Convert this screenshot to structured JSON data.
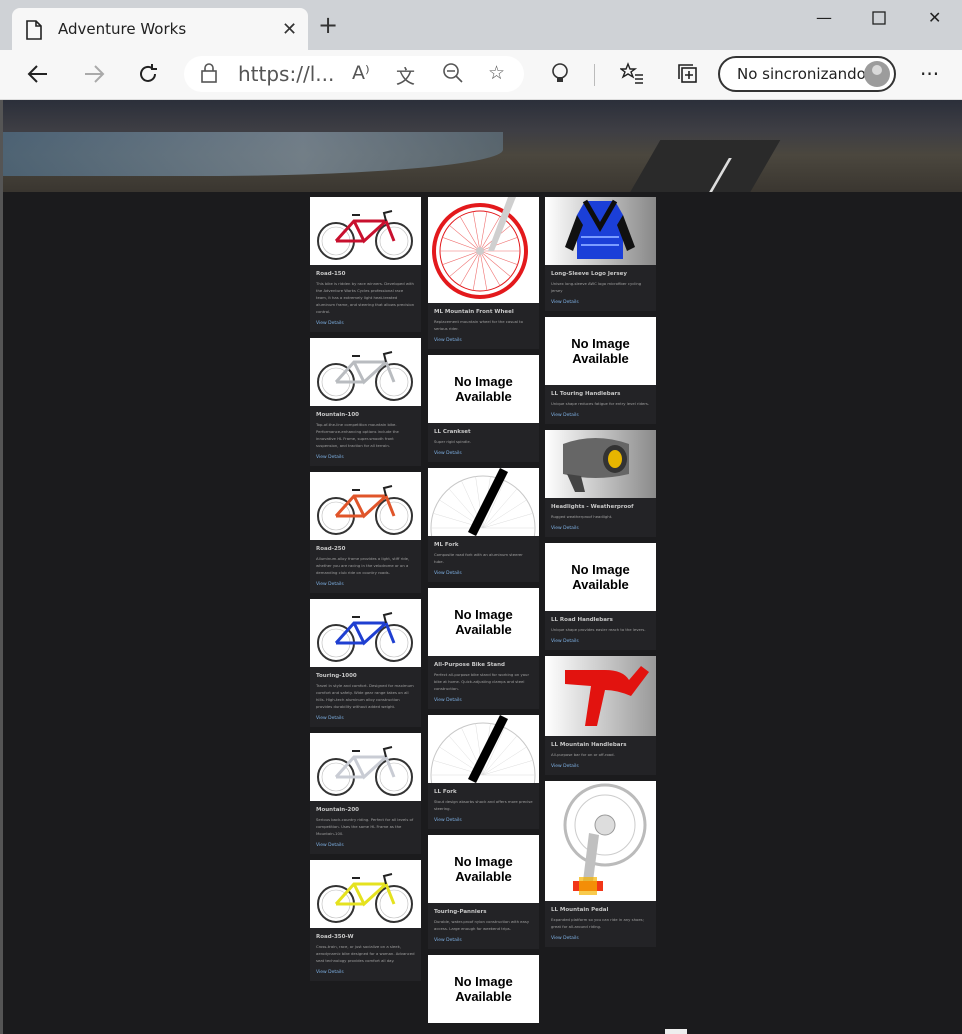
{
  "browser": {
    "tab_title": "Adventure Works",
    "url": "https://l...",
    "sync_label": "No sincronizando",
    "icons": [
      "document-icon",
      "close-icon",
      "plus-icon",
      "minimize-icon",
      "maximize-icon",
      "window-close-icon",
      "back-arrow-icon",
      "forward-arrow-icon",
      "refresh-icon",
      "lock-icon",
      "read-aloud-icon",
      "translate-icon",
      "zoom-icon",
      "favorite-star-icon",
      "extension-icon",
      "favorites-list-icon",
      "collections-icon",
      "more-icon"
    ]
  },
  "products": {
    "col1": [
      {
        "name": "Road-150",
        "desc": "This bike is ridden by race winners. Developed with the Adventure Works Cycles professional race team, it has a extremely light heat-treated aluminum frame, and steering that allows precision control.",
        "link": "View Details",
        "img": "red-bike"
      },
      {
        "name": "Mountain-100",
        "desc": "Top-of-the-line competition mountain bike. Performance-enhancing options include the innovative HL Frame, super-smooth front suspension, and traction for all terrain.",
        "link": "View Details",
        "img": "silver-bike"
      },
      {
        "name": "Road-250",
        "desc": "Alluminum-alloy frame provides a light, stiff ride, whether you are racing in the velodrome or on a demanding club ride on country roads.",
        "link": "View Details",
        "img": "orange-bike"
      },
      {
        "name": "Touring-1000",
        "desc": "Travel in style and comfort. Designed for maximum comfort and safety. Wide gear range takes on all hills. High-tech aluminum alloy construction provides durability without added weight.",
        "link": "View Details",
        "img": "blue-bike"
      },
      {
        "name": "Mountain-200",
        "desc": "Serious back-country riding. Perfect for all levels of competition. Uses the same HL Frame as the Mountain-100.",
        "link": "View Details",
        "img": "silver-bike2"
      },
      {
        "name": "Road-350-W",
        "desc": "Cross-train, race, or just socialize on a sleek, aerodynamic bike designed for a woman. Advanced seat technology provides comfort all day.",
        "link": "View Details",
        "img": "yellow-bike"
      }
    ],
    "col2": [
      {
        "name": "ML Mountain Front Wheel",
        "desc": "Replacement mountain wheel for the casual to serious rider.",
        "link": "View Details",
        "img": "wheel"
      },
      {
        "name": "LL Crankset",
        "desc": "Super rigid spindle.",
        "link": "View Details",
        "img": "noimage"
      },
      {
        "name": "ML Fork",
        "desc": "Composite road fork with an aluminum steerer tube.",
        "link": "View Details",
        "img": "fork"
      },
      {
        "name": "All-Purpose Bike Stand",
        "desc": "Perfect all-purpose bike stand for working on your bike at home. Quick-adjusting clamps and steel construction.",
        "link": "View Details",
        "img": "noimage"
      },
      {
        "name": "LL Fork",
        "desc": "Stout design absorbs shock and offers more precise steering.",
        "link": "View Details",
        "img": "fork"
      },
      {
        "name": "Touring-Panniers",
        "desc": "Durable, water-proof nylon construction with easy access. Large enough for weekend trips.",
        "link": "View Details",
        "img": "noimage"
      },
      {
        "name": "",
        "desc": "",
        "link": "",
        "img": "noimage"
      }
    ],
    "col3": [
      {
        "name": "Long-Sleeve Logo Jersey",
        "desc": "Unisex long-sleeve AWC logo microfiber cycling jersey",
        "link": "View Details",
        "img": "jersey"
      },
      {
        "name": "LL Touring Handlebars",
        "desc": "Unique shape reduces fatigue for entry level riders.",
        "link": "View Details",
        "img": "noimage"
      },
      {
        "name": "Headlights - Weatherproof",
        "desc": "Rugged weatherproof headlight.",
        "link": "View Details",
        "img": "headlight"
      },
      {
        "name": "LL Road Handlebars",
        "desc": "Unique shape provides easier reach to the levers.",
        "link": "View Details",
        "img": "noimage"
      },
      {
        "name": "LL Mountain Handlebars",
        "desc": "All-purpose bar for on or off-road.",
        "link": "View Details",
        "img": "handlebar"
      },
      {
        "name": "LL Mountain Pedal",
        "desc": "Expanded platform so you can ride in any shoes; great for all-around riding.",
        "link": "View Details",
        "img": "pedal"
      }
    ],
    "no_image_text": "No Image Available"
  }
}
